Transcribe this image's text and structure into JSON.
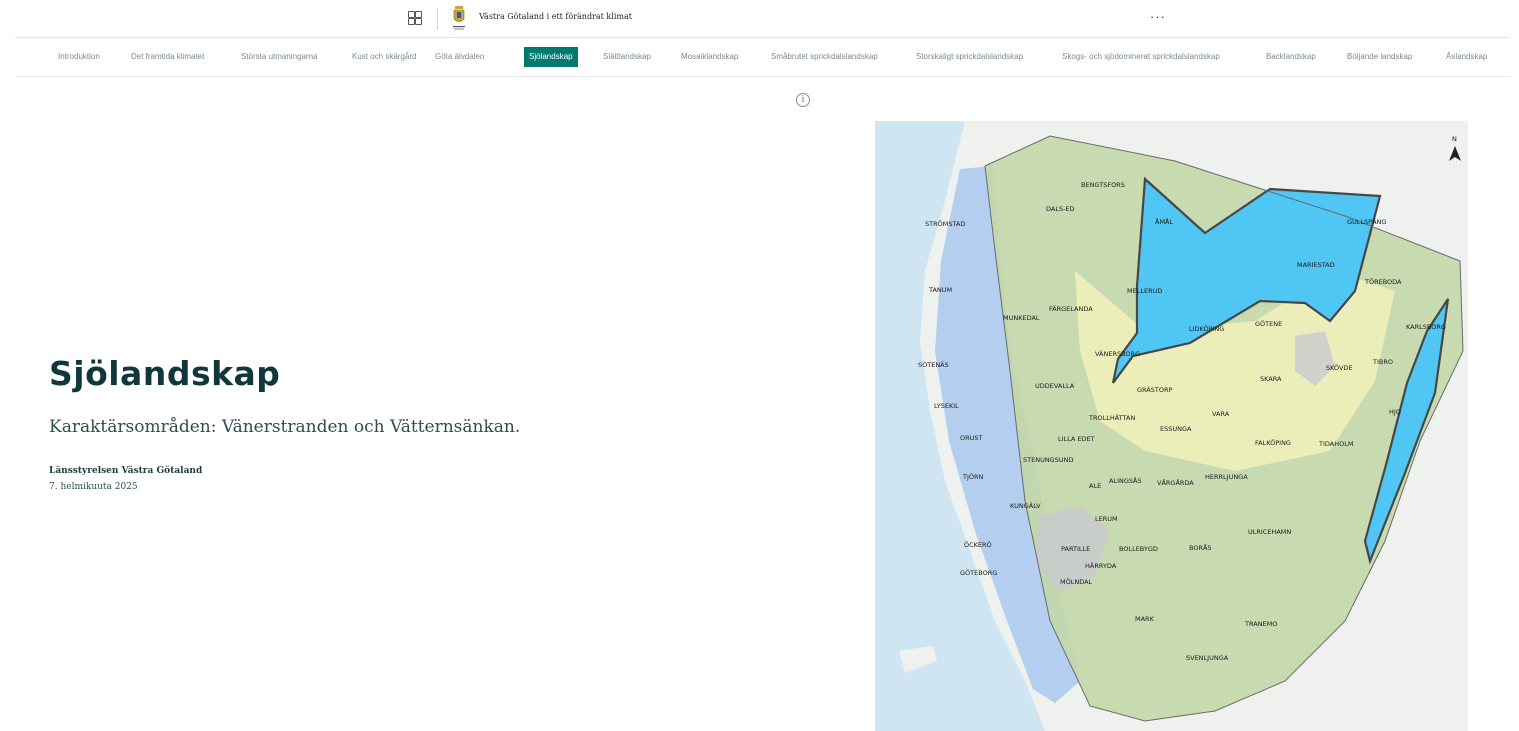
{
  "header": {
    "app_title": "Västra Götaland i ett förändrat klimat",
    "more_label": "···"
  },
  "nav": {
    "tabs": [
      {
        "label": "Introduktion"
      },
      {
        "label": "Det framtida klimatet"
      },
      {
        "label": "Största utmaningarna"
      },
      {
        "label": "Kust och skärgård"
      },
      {
        "label": "Göta älvdalen"
      },
      {
        "label": "Sjölandskap"
      },
      {
        "label": "Slättlandskap"
      },
      {
        "label": "Mosaiklandskap"
      },
      {
        "label": "Småbrutet sprickdalslandskap"
      },
      {
        "label": "Storskaligt sprickdalslandskap"
      },
      {
        "label": "Skogs- och sjödominerat sprickdalslandskap"
      },
      {
        "label": "Backlandskap"
      },
      {
        "label": "Böljande landskap"
      },
      {
        "label": "Åslandskap"
      }
    ],
    "active_index": 5
  },
  "info_label": "i",
  "cover": {
    "title": "Sjölandskap",
    "subtitle": "Karaktärsområden: Vänerstranden och Vätternsänkan.",
    "author": "Länsstyrelsen Västra Götaland",
    "date": "7. helmikuuta 2025"
  },
  "map": {
    "north_label": "N",
    "towns": [
      "BENGTSFORS",
      "DALS-ED",
      "STRÖMSTAD",
      "ÅMÅL",
      "GULLSPÅNG",
      "MARIESTAD",
      "TÖREBODA",
      "MELLERUD",
      "TANUM",
      "FÄRGELANDA",
      "MUNKEDAL",
      "LIDKÖPING",
      "GÖTENE",
      "KARLSBORG",
      "VÄNERSBORG",
      "SOTENÄS",
      "SKÖVDE",
      "TIBRO",
      "UDDEVALLA",
      "GRÄSTORP",
      "SKARA",
      "LYSEKIL",
      "TROLLHÄTTAN",
      "VARA",
      "HJO",
      "ORUST",
      "LILLA EDET",
      "ESSUNGA",
      "FALKÖPING",
      "TIDAHOLM",
      "STENUNGSUND",
      "TJÖRN",
      "ALE",
      "LERUM",
      "ALINGSÅS",
      "VÅRGÅRDA",
      "HERRLJUNGA",
      "KUNGÄLV",
      "ÖCKERÖ",
      "PARTILLE",
      "BOLLEBYGD",
      "BORÅS",
      "ULRICEHAMN",
      "GÖTEBORG",
      "HÄRRYDA",
      "MÖLNDAL",
      "MARK",
      "TRANEMO",
      "SVENLJUNGA"
    ],
    "colors": {
      "sea": "#cfe6f2",
      "land": "#eef1ee",
      "coast_zone": "#a9c8f0",
      "highlight": "#4fc6f4",
      "forest": "#c3d7a8",
      "plain": "#f0f0bb",
      "urban": "#c9c9cf",
      "border": "#474747"
    }
  }
}
